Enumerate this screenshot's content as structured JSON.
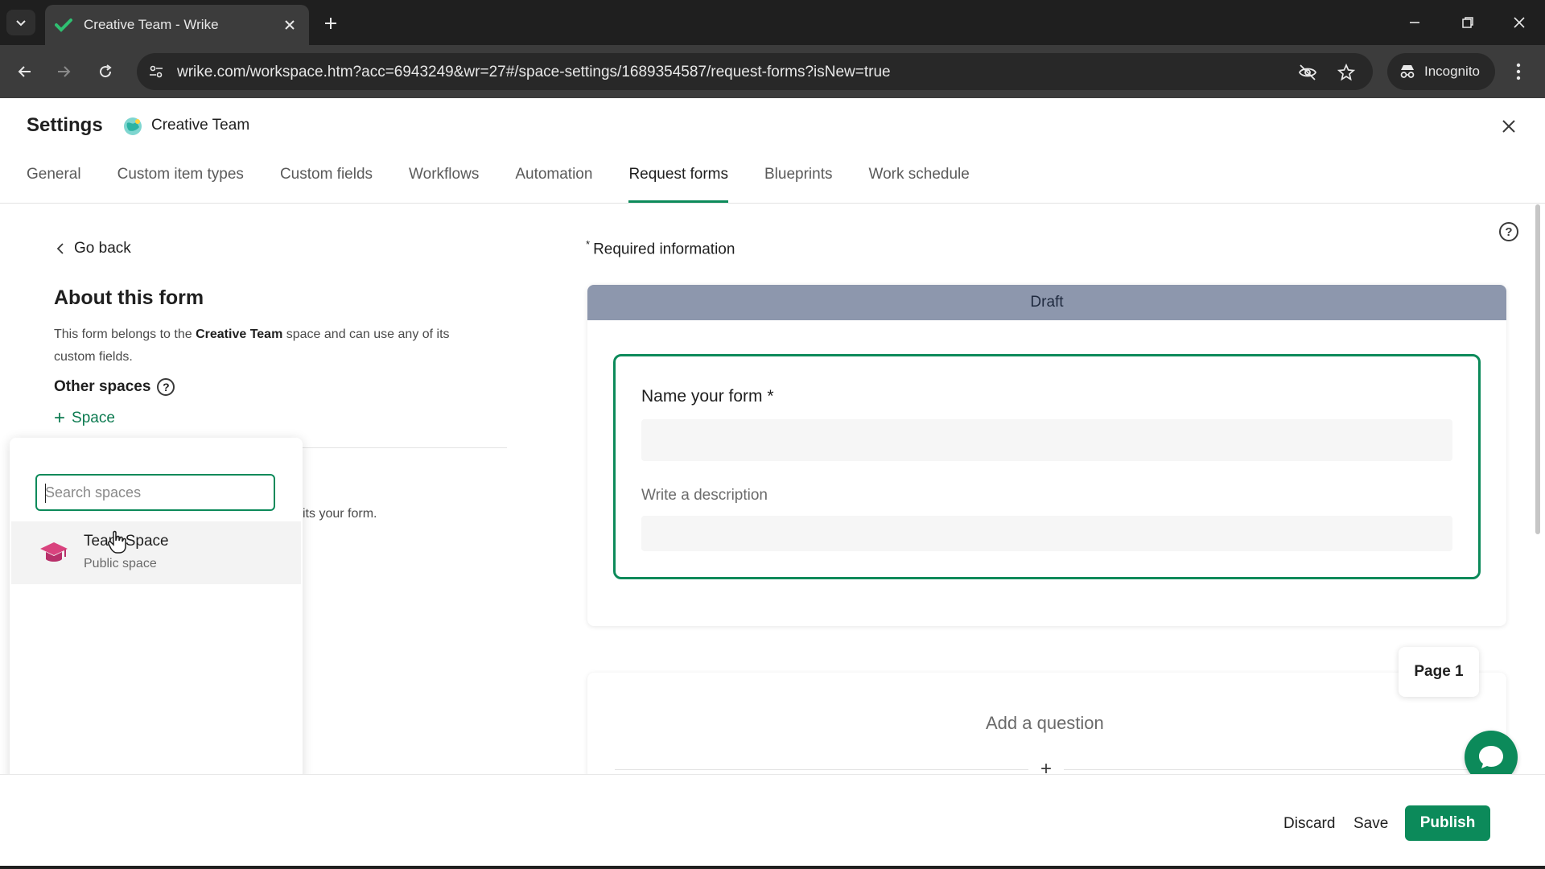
{
  "browser": {
    "tab_title": "Creative Team - Wrike",
    "url": "wrike.com/workspace.htm?acc=6943249&wr=27#/space-settings/1689354587/request-forms?isNew=true",
    "incognito_label": "Incognito"
  },
  "header": {
    "title": "Settings",
    "space_name": "Creative Team"
  },
  "tabs": [
    {
      "label": "General"
    },
    {
      "label": "Custom item types"
    },
    {
      "label": "Custom fields"
    },
    {
      "label": "Workflows"
    },
    {
      "label": "Automation"
    },
    {
      "label": "Request forms",
      "active": true
    },
    {
      "label": "Blueprints"
    },
    {
      "label": "Work schedule"
    }
  ],
  "left": {
    "go_back": "Go back",
    "about_title": "About this form",
    "desc_prefix": "This form belongs to the",
    "desc_space": "Creative Team",
    "desc_suffix": "space and can use any of its custom fields.",
    "other_spaces": "Other spaces",
    "add_space": "Space",
    "behind_text": "its your form."
  },
  "dropdown": {
    "search_placeholder": "Search spaces",
    "items": [
      {
        "name": "Team Space",
        "subtitle": "Public space"
      }
    ]
  },
  "form": {
    "required_info": "Required information",
    "status": "Draft",
    "name_label": "Name your form *",
    "description_label": "Write a description",
    "page_label": "Page 1",
    "add_question": "Add a question"
  },
  "footer": {
    "discard": "Discard",
    "save": "Save",
    "publish": "Publish"
  },
  "colors": {
    "accent": "#0c8a5a",
    "draft_bar": "#8d97ad",
    "space_icon": "#d9437e"
  },
  "icons": [
    "tab-search-icon",
    "wrike-check-icon",
    "close-icon",
    "plus-icon",
    "minimize-icon",
    "restore-icon",
    "back-icon",
    "forward-icon",
    "reload-icon",
    "site-info-icon",
    "eye-off-icon",
    "star-icon",
    "incognito-icon",
    "kebab-icon",
    "chevron-left-icon",
    "help-icon",
    "graduation-cap-icon",
    "chat-icon"
  ]
}
